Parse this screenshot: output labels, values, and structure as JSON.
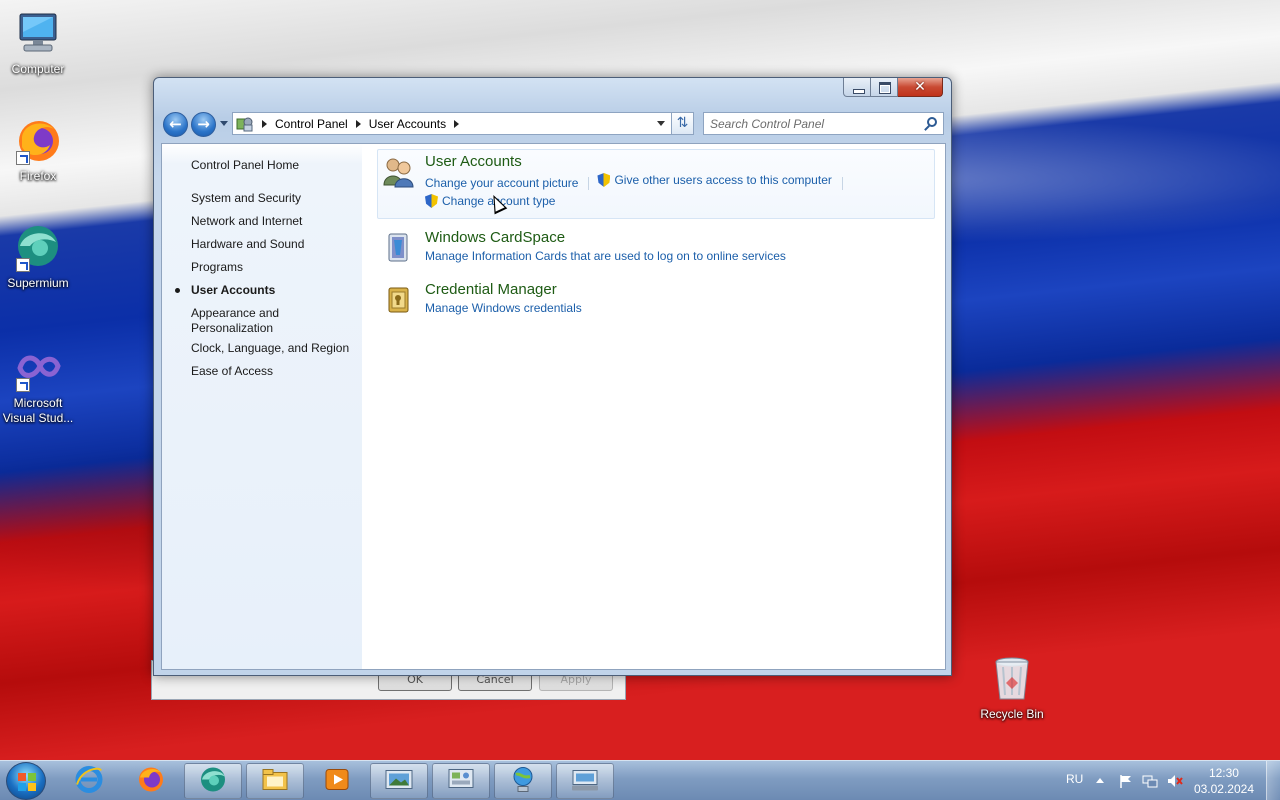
{
  "desktop": {
    "icons": [
      {
        "label": "Computer"
      },
      {
        "label": "Firefox"
      },
      {
        "label": "Supermium"
      },
      {
        "label": "Microsoft Visual Stud..."
      },
      {
        "label": "Recycle Bin"
      }
    ]
  },
  "background_dialog": {
    "ok_label": "OK",
    "cancel_label": "Cancel",
    "apply_label": "Apply"
  },
  "window": {
    "breadcrumb": [
      "Control Panel",
      "User Accounts"
    ],
    "search_placeholder": "Search Control Panel",
    "sidebar": {
      "home": "Control Panel Home",
      "items": [
        {
          "label": "System and Security",
          "active": false
        },
        {
          "label": "Network and Internet",
          "active": false
        },
        {
          "label": "Hardware and Sound",
          "active": false
        },
        {
          "label": "Programs",
          "active": false
        },
        {
          "label": "User Accounts",
          "active": true
        },
        {
          "label": "Appearance and Personalization",
          "active": false
        },
        {
          "label": "Clock, Language, and Region",
          "active": false
        },
        {
          "label": "Ease of Access",
          "active": false
        }
      ]
    },
    "tasks": [
      {
        "title": "User Accounts",
        "icon": "user-accounts-icon",
        "links": [
          "Change your account picture",
          "Give other users access to this computer",
          "Change account type"
        ]
      },
      {
        "title": "Windows CardSpace",
        "icon": "cardspace-icon",
        "links": [
          "Manage Information Cards that are used to log on to online services"
        ]
      },
      {
        "title": "Credential Manager",
        "icon": "credential-manager-icon",
        "links": [
          "Manage Windows credentials"
        ]
      }
    ],
    "close_glyph": "✕"
  },
  "taskbar": {
    "language": "RU",
    "time": "12:30",
    "date": "03.02.2024",
    "pinned": [
      "internet-explorer-icon",
      "firefox-icon",
      "supermium-icon",
      "explorer-icon",
      "media-player-icon",
      "photo-viewer-icon",
      "control-panel-icon",
      "network-icon",
      "keyboard-icon"
    ]
  }
}
